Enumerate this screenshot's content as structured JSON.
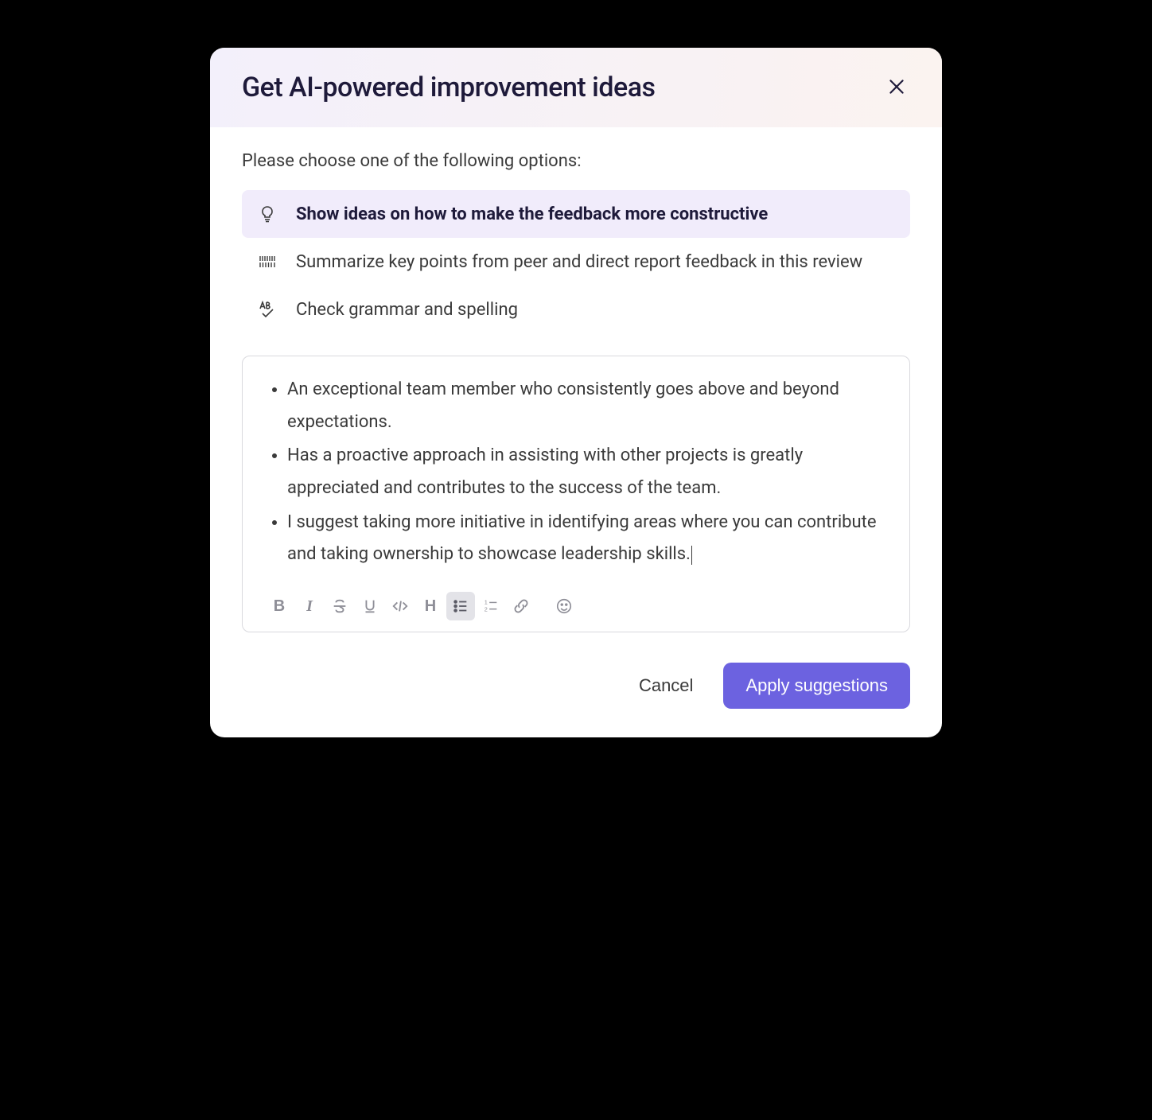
{
  "modal": {
    "title": "Get AI-powered improvement ideas",
    "prompt": "Please choose one of the following options:",
    "options": [
      {
        "label": "Show ideas on how to make the feedback more constructive",
        "icon": "lightbulb",
        "selected": true
      },
      {
        "label": "Summarize key points from peer and direct report feedback in this review",
        "icon": "barcode",
        "selected": false
      },
      {
        "label": "Check grammar and spelling",
        "icon": "spellcheck",
        "selected": false
      }
    ],
    "editor": {
      "bullets": [
        "An exceptional team member who consistently goes above and beyond expectations.",
        "Has a proactive approach in assisting with other projects is greatly appreciated and contributes to the success of the team.",
        "I suggest taking more initiative in identifying areas where you can contribute and taking ownership to showcase leadership skills."
      ]
    },
    "toolbar": {
      "bold": "B",
      "italic": "I",
      "heading": "H"
    },
    "footer": {
      "cancel": "Cancel",
      "apply": "Apply suggestions"
    }
  }
}
